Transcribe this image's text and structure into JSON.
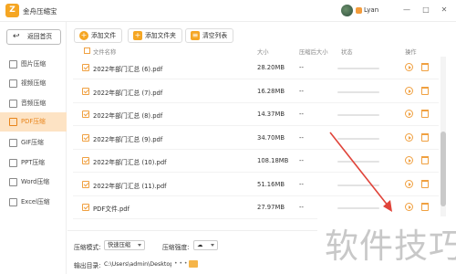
{
  "app": {
    "logo_glyph": "Z",
    "title": "金舟压缩宝",
    "user_name": "Lyan",
    "window_controls": [
      "—",
      "□",
      "✕"
    ]
  },
  "sidebar": {
    "back_label": "返回首页",
    "items": [
      {
        "label": "图片压缩",
        "active": false
      },
      {
        "label": "视频压缩",
        "active": false
      },
      {
        "label": "音频压缩",
        "active": false
      },
      {
        "label": "PDF压缩",
        "active": true
      },
      {
        "label": "GIF压缩",
        "active": false
      },
      {
        "label": "PPT压缩",
        "active": false
      },
      {
        "label": "Word压缩",
        "active": false
      },
      {
        "label": "Excel压缩",
        "active": false
      }
    ]
  },
  "toolbar": {
    "add_file": "添加文件",
    "add_folder": "添加文件夹",
    "clear_list": "清空列表"
  },
  "table": {
    "headers": {
      "name": "文件名称",
      "size": "大小",
      "compressed_size": "压缩后大小",
      "status": "状态",
      "action": "操作"
    },
    "rows": [
      {
        "name": "2022年部门汇总 (6).pdf",
        "size": "28.20MB",
        "compressed": "--",
        "progress": 0
      },
      {
        "name": "2022年部门汇总 (7).pdf",
        "size": "16.28MB",
        "compressed": "--",
        "progress": 0
      },
      {
        "name": "2022年部门汇总 (8).pdf",
        "size": "14.37MB",
        "compressed": "--",
        "progress": 0
      },
      {
        "name": "2022年部门汇总 (9).pdf",
        "size": "34.70MB",
        "compressed": "--",
        "progress": 0
      },
      {
        "name": "2022年部门汇总 (10).pdf",
        "size": "108.18MB",
        "compressed": "--",
        "progress": 0
      },
      {
        "name": "2022年部门汇总 (11).pdf",
        "size": "51.16MB",
        "compressed": "--",
        "progress": 0
      },
      {
        "name": "PDF文件.pdf",
        "size": "27.97MB",
        "compressed": "--",
        "progress": 0
      }
    ]
  },
  "bottom": {
    "mode_label": "压缩模式:",
    "mode_value": "快速压缩",
    "strength_label": "压缩强度:",
    "strength_value": "☁",
    "output_label": "输出目录:",
    "output_path": "C:\\Users\\admin\\Desktop\\金舟",
    "more": "• • •"
  },
  "watermark": "软件技巧",
  "colors": {
    "accent": "#f5a623",
    "active_bg": "#fde3c4",
    "arrow": "#e0443a"
  }
}
